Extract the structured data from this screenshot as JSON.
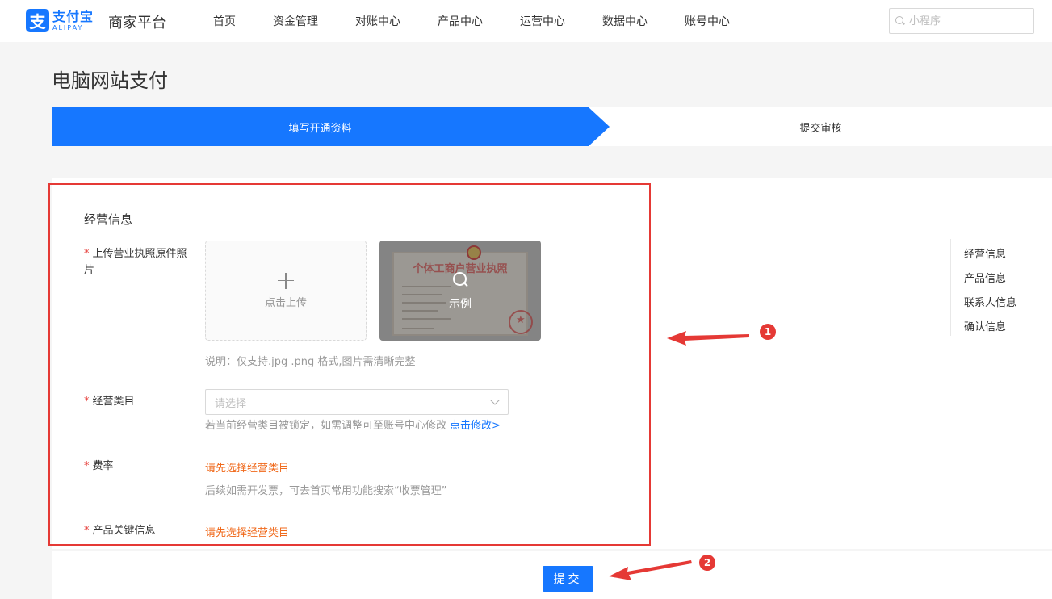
{
  "header": {
    "logo_cn": "支付宝",
    "logo_en": "ALIPAY",
    "logo_mark": "支",
    "platform": "商家平台",
    "nav": [
      "首页",
      "资金管理",
      "对账中心",
      "产品中心",
      "运营中心",
      "数据中心",
      "账号中心"
    ],
    "search_placeholder": "小程序"
  },
  "page": {
    "title": "电脑网站支付"
  },
  "steps": {
    "current": "填写开通资料",
    "next": "提交审核"
  },
  "form": {
    "section_title": "经营信息",
    "required_mark": "*",
    "upload_label": "上传营业执照原件照片",
    "upload_text": "点击上传",
    "example_text": "示例",
    "example_doc_title": "个体工商户营业执照",
    "upload_hint": "说明：仅支持.jpg .png 格式,图片需清晰完整",
    "category_label": "经营类目",
    "category_placeholder": "请选择",
    "category_hint": "若当前经营类目被锁定，如需调整可至账号中心修改",
    "category_link": "点击修改>",
    "rate_label": "费率",
    "rate_warning": "请先选择经营类目",
    "rate_hint": "后续如需开发票，可去首页常用功能搜索“收票管理”",
    "keyword_label": "产品关键信息",
    "keyword_warning": "请先选择经营类目"
  },
  "anchor_nav": [
    "经营信息",
    "产品信息",
    "联系人信息",
    "确认信息"
  ],
  "annotations": {
    "badge_1": "1",
    "badge_2": "2",
    "color": "#e53935"
  },
  "footer": {
    "submit_label": "提交"
  },
  "colors": {
    "primary": "#1677ff",
    "warning": "#f06a1c",
    "danger": "#e53935"
  }
}
